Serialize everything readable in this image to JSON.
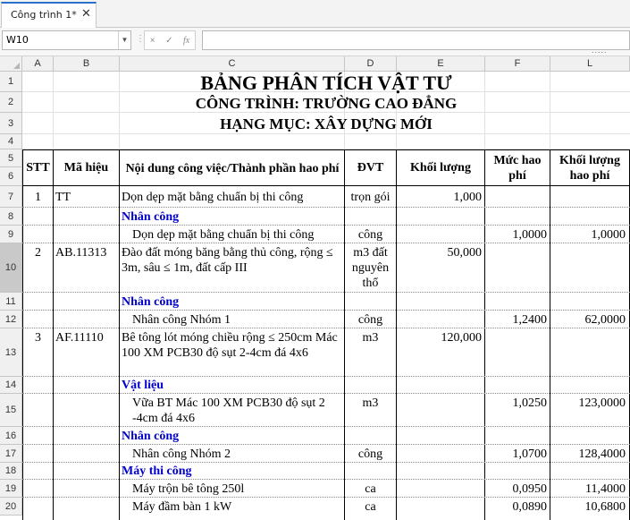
{
  "tab": {
    "label": "Công trình 1*",
    "close": "✕"
  },
  "formula_bar": {
    "cell_ref": "W10",
    "cancel": "×",
    "confirm": "✓",
    "fx": "fx",
    "dots": "....."
  },
  "columns": [
    "A",
    "B",
    "C",
    "D",
    "E",
    "F",
    "L"
  ],
  "rows": [
    "1",
    "2",
    "3",
    "4",
    "5",
    "6",
    "7",
    "8",
    "9",
    "10",
    "11",
    "12",
    "13",
    "14",
    "15",
    "16",
    "17",
    "18",
    "19",
    "20"
  ],
  "selected_row": "10",
  "titles": {
    "main": "BẢNG PHÂN TÍCH VẬT TƯ",
    "project": "CÔNG TRÌNH: TRƯỜNG CAO ĐẲNG",
    "category": "HẠNG MỤC: XÂY DỰNG MỚI"
  },
  "headers": {
    "stt": "STT",
    "code": "Mã hiệu",
    "content": "Nội dung công việc/Thành phần hao phí",
    "unit": "ĐVT",
    "qty": "Khối lượng",
    "rate": "Mức hao phí",
    "consumption": "Khối lượng hao phí"
  },
  "body": [
    {
      "stt": "1",
      "code": "TT",
      "content": "Dọn dẹp mặt bằng chuẩn bị thi công",
      "unit": "trọn gói",
      "qty": "1,000",
      "rate": "",
      "cons": ""
    },
    {
      "section": "Nhân công"
    },
    {
      "content": "Dọn dẹp mặt bằng chuẩn bị thi công",
      "unit": "công",
      "rate": "1,0000",
      "cons": "1,0000"
    },
    {
      "stt": "2",
      "code": "AB.11313",
      "content": "Đào đất móng băng bằng thủ công, rộng ≤ 3m, sâu ≤ 1m, đất cấp III",
      "unit": "m3 đất nguyên thổ",
      "qty": "50,000"
    },
    {
      "section": "Nhân công"
    },
    {
      "content": "Nhân công Nhóm 1",
      "unit": "công",
      "rate": "1,2400",
      "cons": "62,0000"
    },
    {
      "stt": "3",
      "code": "AF.11110",
      "content": "Bê tông lót móng chiều rộng ≤ 250cm Mác 100 XM PCB30 độ sụt 2-4cm đá 4x6",
      "unit": "m3",
      "qty": "120,000"
    },
    {
      "section": "Vật liệu"
    },
    {
      "content": "Vữa BT Mác 100 XM PCB30 độ sụt 2 -4cm đá 4x6",
      "unit": "m3",
      "rate": "1,0250",
      "cons": "123,0000"
    },
    {
      "section": "Nhân công"
    },
    {
      "content": "Nhân công Nhóm 2",
      "unit": "công",
      "rate": "1,0700",
      "cons": "128,4000"
    },
    {
      "section": "Máy thi công"
    },
    {
      "content": "Máy trộn bê tông 250l",
      "unit": "ca",
      "rate": "0,0950",
      "cons": "11,4000"
    },
    {
      "content": "Máy đầm bàn 1 kW",
      "unit": "ca",
      "rate": "0,0890",
      "cons": "10,6800"
    }
  ]
}
